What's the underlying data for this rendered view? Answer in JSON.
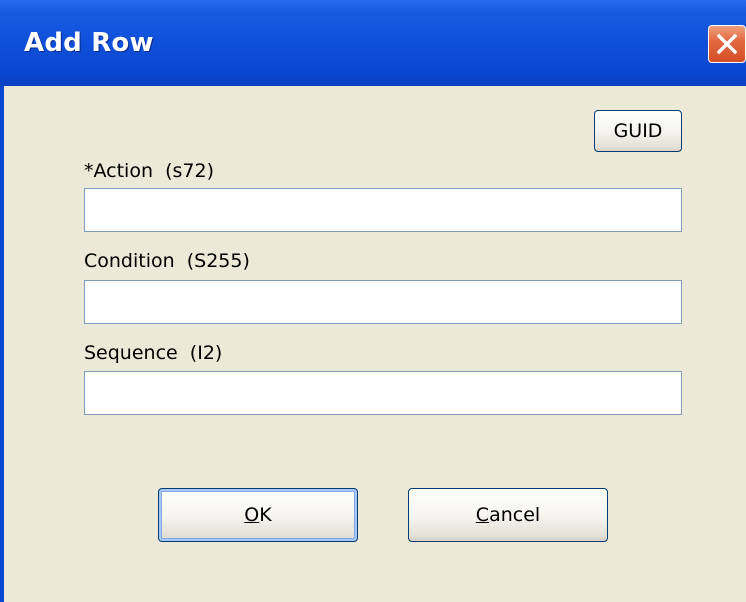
{
  "window": {
    "title": "Add Row"
  },
  "buttons": {
    "guid": "GUID",
    "ok_mnemonic": "O",
    "ok_rest": "K",
    "cancel_mnemonic": "C",
    "cancel_rest": "ancel"
  },
  "fields": [
    {
      "label": "*Action  (s72)",
      "value": ""
    },
    {
      "label": "Condition  (S255)",
      "value": ""
    },
    {
      "label": "Sequence  (I2)",
      "value": ""
    }
  ],
  "icons": {
    "close": "close-icon"
  },
  "colors": {
    "titlebar": "#0f50da",
    "dialog_bg": "#ece9d8",
    "close_button": "#e26a42",
    "field_border": "#7f9db9"
  }
}
